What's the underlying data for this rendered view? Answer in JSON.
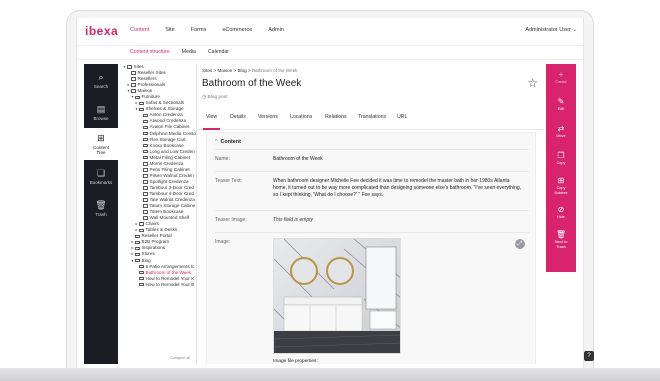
{
  "app": {
    "logo_text": "ibexa",
    "brand_color": "#d8246e",
    "user_menu": "Administrator User ⌄"
  },
  "main_nav": [
    {
      "label": "Content",
      "active": true
    },
    {
      "label": "Site",
      "active": false
    },
    {
      "label": "Forms",
      "active": false
    },
    {
      "label": "eCommerce",
      "active": false
    },
    {
      "label": "Admin",
      "active": false
    }
  ],
  "sub_nav": [
    {
      "label": "Content structure",
      "active": true
    },
    {
      "label": "Media",
      "active": false
    },
    {
      "label": "Calendar",
      "active": false
    }
  ],
  "left_rail": [
    {
      "label": "Search",
      "icon": "search-icon",
      "glyph": "⌕"
    },
    {
      "label": "Browse",
      "icon": "browse-icon",
      "glyph": "▤"
    },
    {
      "label": "Content Tree",
      "icon": "content-tree-icon",
      "glyph": "⊞"
    },
    {
      "label": "Bookmarks",
      "icon": "bookmarks-icon",
      "glyph": "❏"
    },
    {
      "label": "Trash",
      "icon": "trash-icon",
      "glyph": "🗑"
    }
  ],
  "tree": {
    "items": [
      {
        "label": "Sites",
        "depth": 0,
        "toggle": "▾"
      },
      {
        "label": "Reseller Sites",
        "depth": 1,
        "toggle": ""
      },
      {
        "label": "Resellers",
        "depth": 1,
        "toggle": ""
      },
      {
        "label": "Professionals",
        "depth": 1,
        "toggle": "▸"
      },
      {
        "label": "Maison",
        "depth": 1,
        "toggle": "▾"
      },
      {
        "label": "Furniture",
        "depth": 2,
        "toggle": "▾"
      },
      {
        "label": "Sofas & Sectionals",
        "depth": 3,
        "toggle": "▸"
      },
      {
        "label": "Shelves & Storage",
        "depth": 3,
        "toggle": "▾"
      },
      {
        "label": "Anton Credenza",
        "depth": 4,
        "toggle": ""
      },
      {
        "label": "Atwood Credenza",
        "depth": 4,
        "toggle": ""
      },
      {
        "label": "Avalon File Cabinet",
        "depth": 4,
        "toggle": ""
      },
      {
        "label": "Delphine Media Conso",
        "depth": 4,
        "toggle": ""
      },
      {
        "label": "Flex Storage Cart",
        "depth": 4,
        "toggle": ""
      },
      {
        "label": "Knoxx Bookcase",
        "depth": 4,
        "toggle": ""
      },
      {
        "label": "Long and Low Creden",
        "depth": 4,
        "toggle": ""
      },
      {
        "label": "Metal Filing Cabinet",
        "depth": 4,
        "toggle": ""
      },
      {
        "label": "Morris Credenza",
        "depth": 4,
        "toggle": ""
      },
      {
        "label": "Penn Filing Cabinet",
        "depth": 4,
        "toggle": ""
      },
      {
        "label": "Pilsen Walnut Creden",
        "depth": 4,
        "toggle": ""
      },
      {
        "label": "Spotlight Credenza",
        "depth": 4,
        "toggle": ""
      },
      {
        "label": "Tambour 3-Door Cred",
        "depth": 4,
        "toggle": ""
      },
      {
        "label": "Tambour 4-Door Cred",
        "depth": 4,
        "toggle": ""
      },
      {
        "label": "Tate Walnut Credenza",
        "depth": 4,
        "toggle": ""
      },
      {
        "label": "Tatum Storage Cabine",
        "depth": 4,
        "toggle": ""
      },
      {
        "label": "Totem Bookcase",
        "depth": 4,
        "toggle": ""
      },
      {
        "label": "Wall Mounted Shelf",
        "depth": 4,
        "toggle": ""
      },
      {
        "label": "Chairs",
        "depth": 3,
        "toggle": "▸"
      },
      {
        "label": "Tables & Desks",
        "depth": 3,
        "toggle": "▸"
      },
      {
        "label": "Reseller Portal",
        "depth": 2,
        "toggle": ""
      },
      {
        "label": "B2B Program",
        "depth": 2,
        "toggle": "▸"
      },
      {
        "label": "Inspirations",
        "depth": 2,
        "toggle": "▸"
      },
      {
        "label": "Stores",
        "depth": 2,
        "toggle": "▸"
      },
      {
        "label": "Blog",
        "depth": 2,
        "toggle": "▾"
      },
      {
        "label": "5 Patio Arrangements fc",
        "depth": 3,
        "toggle": ""
      },
      {
        "label": "Bathroom of the Week",
        "depth": 3,
        "toggle": "",
        "selected": true
      },
      {
        "label": "How to Remodel Your K",
        "depth": 3,
        "toggle": ""
      },
      {
        "label": "How to Remodel Your B",
        "depth": 3,
        "toggle": ""
      }
    ],
    "footer": "Collapse all"
  },
  "content": {
    "breadcrumb": "Sites > Maison > Blog > ",
    "breadcrumb_current": "Bathroom of the Week",
    "title": "Bathroom of the Week",
    "content_type": "Blog post",
    "tabs": [
      {
        "label": "View",
        "active": true
      },
      {
        "label": "Details",
        "active": false
      },
      {
        "label": "Versions",
        "active": false
      },
      {
        "label": "Locations",
        "active": false
      },
      {
        "label": "Relations",
        "active": false
      },
      {
        "label": "Translations",
        "active": false
      },
      {
        "label": "URL",
        "active": false
      }
    ],
    "section_label": "Content",
    "fields": {
      "name_label": "Name:",
      "name_value": "Bathroom of the Week",
      "teaser_text_label": "Teaser Text:",
      "teaser_text_value": "When bathroom designer Michelle Fee decided it was time to remodel the master bath in her 1980s Atlanta home, it turned out to be way more complicated than designing someone else's bathroom. \"I've seen everything, so I kept thinking, 'What do I choose?' \" Fee says.",
      "teaser_image_label": "Teaser Image:",
      "teaser_image_value": "This field is empty",
      "image_label": "Image:",
      "image_file_properties": "Image file properties:"
    }
  },
  "right_actions": [
    {
      "label": "Create",
      "icon": "plus-icon",
      "glyph": "+"
    },
    {
      "label": "Edit",
      "icon": "edit-icon",
      "glyph": "✎"
    },
    {
      "label": "Move",
      "icon": "move-icon",
      "glyph": "⇄"
    },
    {
      "label": "Copy",
      "icon": "copy-icon",
      "glyph": "❐"
    },
    {
      "label": "Copy Subtree",
      "icon": "copy-subtree-icon",
      "glyph": "⊞"
    },
    {
      "label": "Hide",
      "icon": "hide-icon",
      "glyph": "⊘"
    },
    {
      "label": "Send to Trash",
      "icon": "trash-icon",
      "glyph": "🗑"
    }
  ],
  "help_icon": "help-icon"
}
